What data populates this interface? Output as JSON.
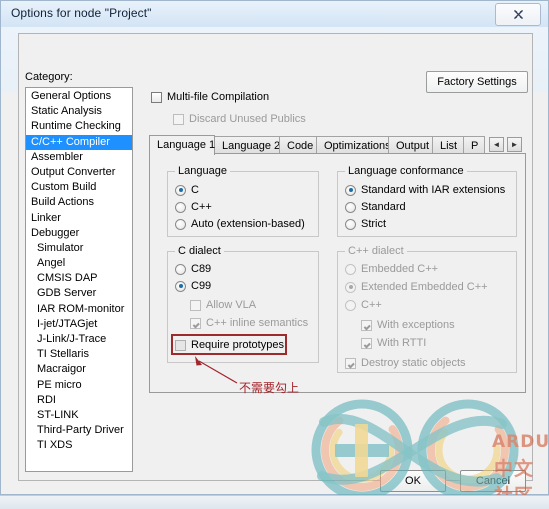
{
  "window": {
    "title": "Options for node \"Project\"",
    "close_label": "✖"
  },
  "category": {
    "label": "Category:",
    "items": [
      {
        "label": "General Options",
        "sub": false,
        "selected": false
      },
      {
        "label": "Static Analysis",
        "sub": false,
        "selected": false
      },
      {
        "label": "Runtime Checking",
        "sub": false,
        "selected": false
      },
      {
        "label": "C/C++ Compiler",
        "sub": false,
        "selected": true
      },
      {
        "label": "Assembler",
        "sub": false,
        "selected": false
      },
      {
        "label": "Output Converter",
        "sub": false,
        "selected": false
      },
      {
        "label": "Custom Build",
        "sub": false,
        "selected": false
      },
      {
        "label": "Build Actions",
        "sub": false,
        "selected": false
      },
      {
        "label": "Linker",
        "sub": false,
        "selected": false
      },
      {
        "label": "Debugger",
        "sub": false,
        "selected": false
      },
      {
        "label": "Simulator",
        "sub": true,
        "selected": false
      },
      {
        "label": "Angel",
        "sub": true,
        "selected": false
      },
      {
        "label": "CMSIS DAP",
        "sub": true,
        "selected": false
      },
      {
        "label": "GDB Server",
        "sub": true,
        "selected": false
      },
      {
        "label": "IAR ROM-monitor",
        "sub": true,
        "selected": false
      },
      {
        "label": "I-jet/JTAGjet",
        "sub": true,
        "selected": false
      },
      {
        "label": "J-Link/J-Trace",
        "sub": true,
        "selected": false
      },
      {
        "label": "TI Stellaris",
        "sub": true,
        "selected": false
      },
      {
        "label": "Macraigor",
        "sub": true,
        "selected": false
      },
      {
        "label": "PE micro",
        "sub": true,
        "selected": false
      },
      {
        "label": "RDI",
        "sub": true,
        "selected": false
      },
      {
        "label": "ST-LINK",
        "sub": true,
        "selected": false
      },
      {
        "label": "Third-Party Driver",
        "sub": true,
        "selected": false
      },
      {
        "label": "TI XDS",
        "sub": true,
        "selected": false
      }
    ]
  },
  "toolbar": {
    "factory_settings_label": "Factory Settings"
  },
  "options": {
    "multi_file_compilation": {
      "label": "Multi-file Compilation",
      "checked": false,
      "enabled": true
    },
    "discard_unused_publics": {
      "label": "Discard Unused Publics",
      "checked": false,
      "enabled": false
    }
  },
  "tabs": {
    "items": [
      {
        "label": "Language 1",
        "active": true
      },
      {
        "label": "Language 2",
        "active": false
      },
      {
        "label": "Code",
        "active": false
      },
      {
        "label": "Optimizations",
        "active": false
      },
      {
        "label": "Output",
        "active": false
      },
      {
        "label": "List",
        "active": false
      },
      {
        "label": "P",
        "active": false
      }
    ],
    "scroll_left": "◄",
    "scroll_right": "►"
  },
  "groups": {
    "language": {
      "title": "Language",
      "options": [
        {
          "label": "C",
          "selected": true,
          "enabled": true
        },
        {
          "label": "C++",
          "selected": false,
          "enabled": true
        },
        {
          "label": "Auto (extension-based)",
          "selected": false,
          "enabled": true
        }
      ]
    },
    "language_conformance": {
      "title": "Language conformance",
      "options": [
        {
          "label": "Standard with IAR extensions",
          "selected": true,
          "enabled": true
        },
        {
          "label": "Standard",
          "selected": false,
          "enabled": true
        },
        {
          "label": "Strict",
          "selected": false,
          "enabled": true
        }
      ]
    },
    "c_dialect": {
      "title": "C dialect",
      "options": [
        {
          "label": "C89",
          "selected": false,
          "enabled": true
        },
        {
          "label": "C99",
          "selected": true,
          "enabled": true
        }
      ],
      "checks": [
        {
          "label": "Allow VLA",
          "checked": false,
          "enabled": false
        },
        {
          "label": "C++ inline semantics",
          "checked": true,
          "enabled": false
        }
      ],
      "require_prototypes": {
        "label": "Require prototypes",
        "checked": false,
        "enabled": true
      }
    },
    "cpp_dialect": {
      "title": "C++ dialect",
      "options": [
        {
          "label": "Embedded C++",
          "selected": false,
          "enabled": false
        },
        {
          "label": "Extended Embedded C++",
          "selected": true,
          "enabled": false
        },
        {
          "label": "C++",
          "selected": false,
          "enabled": false
        }
      ],
      "checks": [
        {
          "label": "With exceptions",
          "checked": true,
          "enabled": false
        },
        {
          "label": "With RTTI",
          "checked": true,
          "enabled": false
        },
        {
          "label": "Destroy static objects",
          "checked": true,
          "enabled": false
        }
      ]
    }
  },
  "annotation": {
    "text": "不需要勾上",
    "color": "#a3242a",
    "highlight_color": "#9e2b2b"
  },
  "footer": {
    "ok_label": "OK",
    "cancel_label": "Cancel"
  },
  "watermark": {
    "brand": "ARDUINO",
    "subtitle": "中文社区",
    "teal": "#5fb3b8",
    "orange": "#f0a882",
    "yellow": "#f2cf72"
  }
}
